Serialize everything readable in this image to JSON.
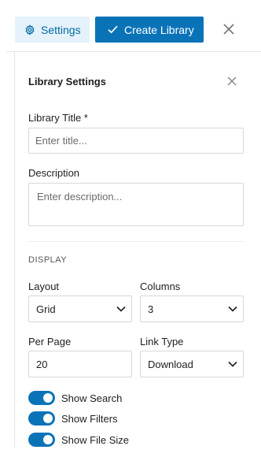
{
  "toolbar": {
    "settings_label": "Settings",
    "create_label": "Create Library",
    "accent": "#0a73b8",
    "settings_bg": "#e5f2fb"
  },
  "panel": {
    "title": "Library Settings",
    "fields": {
      "title_label": "Library Title *",
      "title_placeholder": "Enter title...",
      "description_label": "Description",
      "description_placeholder": "Enter description..."
    },
    "display": {
      "section_title": "DISPLAY",
      "layout_label": "Layout",
      "layout_value": "Grid",
      "columns_label": "Columns",
      "columns_value": "3",
      "per_page_label": "Per Page",
      "per_page_value": "20",
      "link_type_label": "Link Type",
      "link_type_value": "Download"
    },
    "toggles": [
      {
        "label": "Show Search",
        "on": true
      },
      {
        "label": "Show Filters",
        "on": true
      },
      {
        "label": "Show File Size",
        "on": true
      }
    ]
  },
  "icons": {
    "settings": "gear-icon",
    "create": "check-icon",
    "close": "close-icon",
    "dropdown": "chevron-down-icon"
  }
}
